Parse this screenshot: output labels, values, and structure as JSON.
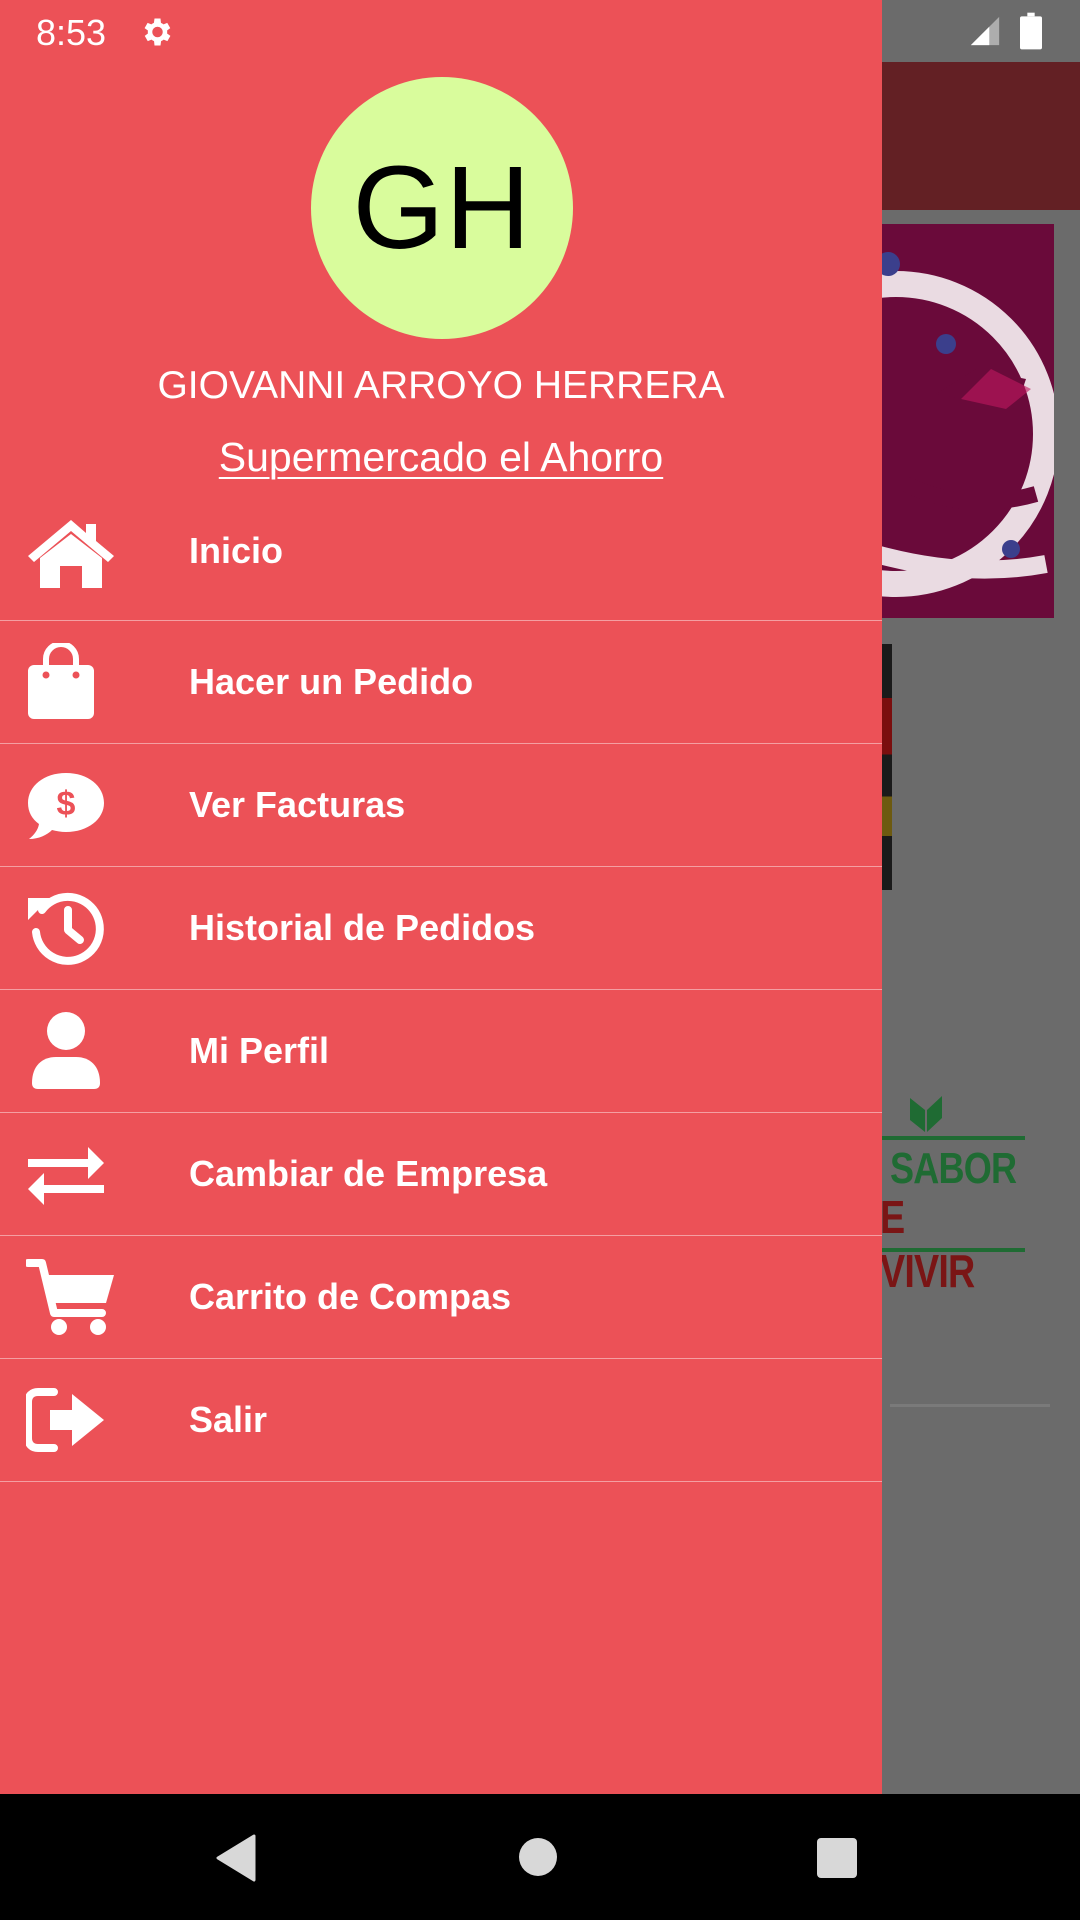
{
  "status_bar": {
    "time": "8:53",
    "icons": [
      "gear-icon",
      "signal-icon",
      "battery-icon"
    ]
  },
  "drawer": {
    "background_color": "#ec5157",
    "avatar": {
      "initials": "GH",
      "color": "#d9fc9c"
    },
    "user_name": "GIOVANNI ARROYO HERRERA",
    "company": "Supermercado el Ahorro",
    "menu_items": [
      {
        "label": "Inicio",
        "icon": "home-icon"
      },
      {
        "label": "Hacer un Pedido",
        "icon": "shopping-bag-icon"
      },
      {
        "label": "Ver Facturas",
        "icon": "dollar-chat-icon"
      },
      {
        "label": "Historial de Pedidos",
        "icon": "history-icon"
      },
      {
        "label": "Mi Perfil",
        "icon": "user-icon"
      },
      {
        "label": "Cambiar de Empresa",
        "icon": "exchange-icon"
      },
      {
        "label": "Carrito de Compas",
        "icon": "cart-icon"
      },
      {
        "label": "Salir",
        "icon": "sign-out-icon"
      }
    ]
  },
  "background": {
    "logo_top": "SABOR",
    "logo_bottom": "E VIVIR"
  },
  "nav_bar": {
    "buttons": [
      "back-button",
      "home-button",
      "recents-button"
    ]
  }
}
